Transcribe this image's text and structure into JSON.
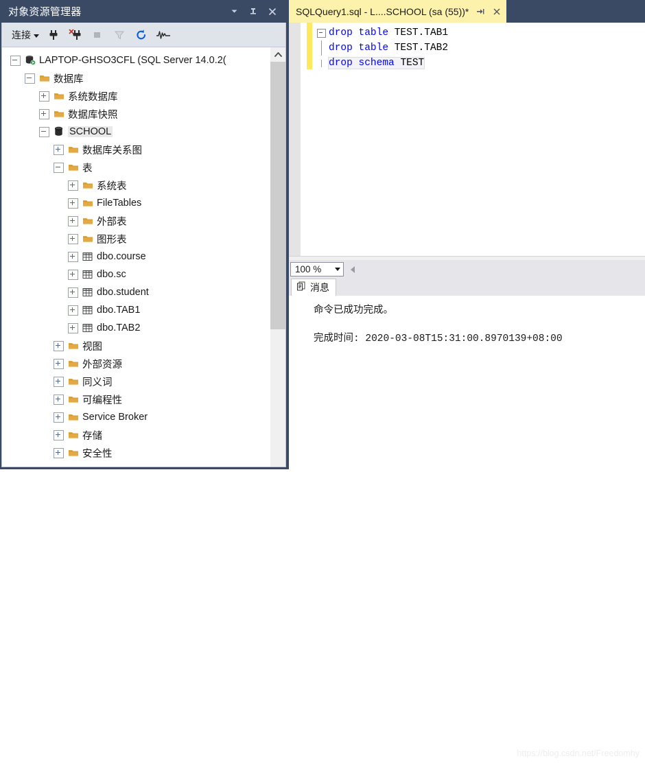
{
  "object_explorer": {
    "title": "对象资源管理器",
    "title_buttons": [
      {
        "name": "dropdown-icon",
        "glyph": "▾"
      },
      {
        "name": "pin-icon",
        "glyph": "⊥"
      },
      {
        "name": "close-icon",
        "glyph": "✕"
      }
    ],
    "toolbar": {
      "connect_label": "连接",
      "icons": [
        "connect-icon",
        "disconnect-icon",
        "stop-icon",
        "filter-icon",
        "refresh-icon",
        "activity-monitor-icon"
      ]
    },
    "tree": [
      {
        "label": "LAPTOP-GHSO3CFL (SQL Server 14.0.2(",
        "depth": 0,
        "state": "minus",
        "icon": "server-icon",
        "selected": false
      },
      {
        "label": "数据库",
        "depth": 1,
        "state": "minus",
        "icon": "folder-icon",
        "selected": false
      },
      {
        "label": "系统数据库",
        "depth": 2,
        "state": "plus",
        "icon": "folder-icon",
        "selected": false
      },
      {
        "label": "数据库快照",
        "depth": 2,
        "state": "plus",
        "icon": "folder-icon",
        "selected": false
      },
      {
        "label": "SCHOOL",
        "depth": 2,
        "state": "minus",
        "icon": "database-icon",
        "selected": true
      },
      {
        "label": "数据库关系图",
        "depth": 3,
        "state": "plus",
        "icon": "folder-icon",
        "selected": false
      },
      {
        "label": "表",
        "depth": 3,
        "state": "minus",
        "icon": "folder-icon",
        "selected": false
      },
      {
        "label": "系统表",
        "depth": 4,
        "state": "plus",
        "icon": "folder-icon",
        "selected": false
      },
      {
        "label": "FileTables",
        "depth": 4,
        "state": "plus",
        "icon": "folder-icon",
        "selected": false
      },
      {
        "label": "外部表",
        "depth": 4,
        "state": "plus",
        "icon": "folder-icon",
        "selected": false
      },
      {
        "label": "图形表",
        "depth": 4,
        "state": "plus",
        "icon": "folder-icon",
        "selected": false
      },
      {
        "label": "dbo.course",
        "depth": 4,
        "state": "plus",
        "icon": "table-icon",
        "selected": false
      },
      {
        "label": "dbo.sc",
        "depth": 4,
        "state": "plus",
        "icon": "table-icon",
        "selected": false
      },
      {
        "label": "dbo.student",
        "depth": 4,
        "state": "plus",
        "icon": "table-icon",
        "selected": false
      },
      {
        "label": "dbo.TAB1",
        "depth": 4,
        "state": "plus",
        "icon": "table-icon",
        "selected": false
      },
      {
        "label": "dbo.TAB2",
        "depth": 4,
        "state": "plus",
        "icon": "table-icon",
        "selected": false
      },
      {
        "label": "视图",
        "depth": 3,
        "state": "plus",
        "icon": "folder-icon",
        "selected": false
      },
      {
        "label": "外部资源",
        "depth": 3,
        "state": "plus",
        "icon": "folder-icon",
        "selected": false
      },
      {
        "label": "同义词",
        "depth": 3,
        "state": "plus",
        "icon": "folder-icon",
        "selected": false
      },
      {
        "label": "可编程性",
        "depth": 3,
        "state": "plus",
        "icon": "folder-icon",
        "selected": false
      },
      {
        "label": "Service Broker",
        "depth": 3,
        "state": "plus",
        "icon": "folder-icon",
        "selected": false
      },
      {
        "label": "存储",
        "depth": 3,
        "state": "plus",
        "icon": "folder-icon",
        "selected": false
      },
      {
        "label": "安全性",
        "depth": 3,
        "state": "plus",
        "icon": "folder-icon",
        "selected": false
      }
    ],
    "scrollbar": {
      "up_arrow": "⌃"
    }
  },
  "editor": {
    "tab_title": "SQLQuery1.sql - L....SCHOOL (sa (55))*",
    "tab_buttons": [
      {
        "name": "pin-tab-icon",
        "glyph": "⇥"
      },
      {
        "name": "close-tab-icon",
        "glyph": "✕"
      }
    ],
    "code": [
      {
        "kw1": "drop",
        "kw2": "table",
        "ident": "TEST.TAB1",
        "folded": true,
        "current": false
      },
      {
        "kw1": "drop",
        "kw2": "table",
        "ident": "TEST.TAB2",
        "folded": false,
        "current": false
      },
      {
        "kw1": "drop",
        "kw2": "schema",
        "ident": "TEST",
        "folded": false,
        "current": true
      }
    ]
  },
  "results": {
    "zoom_value": "100 %",
    "tab_label": "消息",
    "messages": [
      "命令已成功完成。",
      "完成时间: 2020-03-08T15:31:00.8970139+08:00"
    ]
  },
  "watermark": "https://blog.csdn.net/Freedomhy",
  "colors": {
    "chrome": "#3b4a64",
    "tab_active": "#fdf2ab",
    "keyword": "#0000ff",
    "change_bar": "#ffe95c",
    "folder": "#e0a845"
  }
}
